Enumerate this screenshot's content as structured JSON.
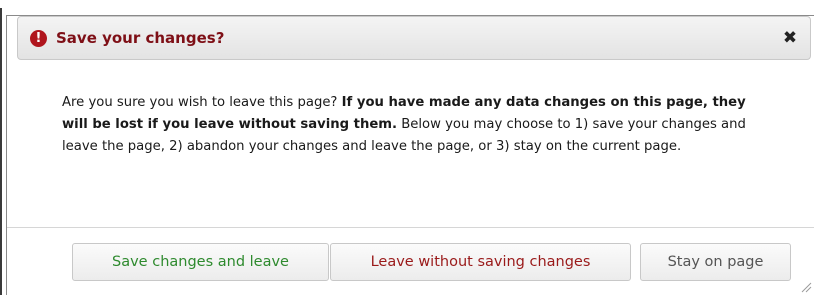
{
  "dialog": {
    "title": "Save your changes?",
    "title_icon": "exclamation-icon",
    "close_label": "✖",
    "message": {
      "intro": "Are you sure you wish to leave this page? ",
      "warning": "If you have made any data changes on this page, they will be lost if you leave without saving them.",
      "options": " Below you may choose to 1) save your changes and leave the page, 2) abandon your changes and leave the page, or 3) stay on the current page."
    },
    "buttons": {
      "save_label": "Save changes and leave",
      "leave_label": "Leave without saving changes",
      "stay_label": "Stay on page"
    }
  },
  "colors": {
    "title": "#7e0f16",
    "icon": "#b0151d",
    "save": "#2e8a2e",
    "leave": "#9a1a1a",
    "stay": "#555555"
  }
}
